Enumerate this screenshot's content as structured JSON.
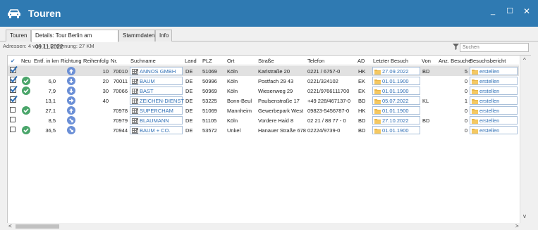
{
  "window": {
    "title": "Touren",
    "icon": "car-icon"
  },
  "window_controls": {
    "minimize": "_",
    "maximize": "☐",
    "close": "✕"
  },
  "tabs": [
    {
      "label": "Touren",
      "active": false
    },
    {
      "label": "Details: Tour Berlin am 09.11.2022",
      "active": true
    },
    {
      "label": "Stammdaten",
      "active": false
    },
    {
      "label": "Info",
      "active": false
    }
  ],
  "info": "Adressen: 4 von 7 - Entfernung: 27 KM",
  "search": {
    "placeholder": "Suchen"
  },
  "columns": {
    "check": "✔",
    "neu": "Neu",
    "entf": "Entf. in km",
    "richtung": "Richtung",
    "reihenfolge": "Reihenfolg",
    "nr": "Nr.",
    "suchname": "Suchname",
    "land": "Land",
    "plz": "PLZ",
    "ort": "Ort",
    "strasse": "Straße",
    "telefon": "Telefon",
    "ad": "AD",
    "letzter": "Letzter Besuch",
    "von": "Von",
    "anz": "Anz. Besuche",
    "bericht": "Besuchsbericht"
  },
  "rows": [
    {
      "checked": true,
      "neu": false,
      "entf": "",
      "richtung": "up",
      "reihenfolge": "10",
      "nr": "70010",
      "suchname": "ANNOS GMBH",
      "land": "DE",
      "plz": "51069",
      "ort": "Köln",
      "strasse": "Karlstraße 20",
      "telefon": "0221 / 6757-0",
      "ad": "HK",
      "letzter": "27.09.2022",
      "von": "BD",
      "anz": "5",
      "bericht": "erstellen",
      "selected": true
    },
    {
      "checked": true,
      "neu": true,
      "entf": "6,0",
      "richtung": "down",
      "reihenfolge": "20",
      "nr": "70011",
      "suchname": "BAUM",
      "land": "DE",
      "plz": "50996",
      "ort": "Köln",
      "strasse": "Postfach 29 43",
      "telefon": "0221/324102",
      "ad": "EK",
      "letzter": "01.01.1900",
      "von": "",
      "anz": "0",
      "bericht": "erstellen",
      "selected": false
    },
    {
      "checked": true,
      "neu": true,
      "entf": "7,9",
      "richtung": "down",
      "reihenfolge": "30",
      "nr": "70066",
      "suchname": "BAST",
      "land": "DE",
      "plz": "50969",
      "ort": "Köln",
      "strasse": "Wiesenweg 29",
      "telefon": "0221/9766111700",
      "ad": "EK",
      "letzter": "01.01.1900",
      "von": "",
      "anz": "0",
      "bericht": "erstellen",
      "selected": false
    },
    {
      "checked": true,
      "neu": false,
      "entf": "13,1",
      "richtung": "right",
      "reihenfolge": "40",
      "nr": "",
      "suchname": "ZEICHEN-DIENST",
      "land": "DE",
      "plz": "53225",
      "ort": "Bonn-Beul",
      "strasse": "Paulsenstraße 17",
      "telefon": "+49 228/467137-0",
      "ad": "BD",
      "letzter": "05.07.2022",
      "von": "KL",
      "anz": "1",
      "bericht": "erstellen",
      "selected": false
    },
    {
      "checked": false,
      "neu": true,
      "entf": "27,1",
      "richtung": "up",
      "reihenfolge": "",
      "nr": "70978",
      "suchname": "SUPERCHAM",
      "land": "DE",
      "plz": "51069",
      "ort": "Mannheim",
      "strasse": "Gewerbepark West",
      "telefon": "09823-5456787-0",
      "ad": "HK",
      "letzter": "01.01.1900",
      "von": "",
      "anz": "0",
      "bericht": "erstellen",
      "selected": false
    },
    {
      "checked": false,
      "neu": false,
      "entf": "8,5",
      "richtung": "downright",
      "reihenfolge": "",
      "nr": "70979",
      "suchname": "BLAUMANN",
      "land": "DE",
      "plz": "51105",
      "ort": "Köln",
      "strasse": "Vordere Haid 8",
      "telefon": "02 21 / 88 77 - 0",
      "ad": "BD",
      "letzter": "27.10.2022",
      "von": "BD",
      "anz": "0",
      "bericht": "erstellen",
      "selected": false
    },
    {
      "checked": false,
      "neu": true,
      "entf": "36,5",
      "richtung": "downright",
      "reihenfolge": "",
      "nr": "70944",
      "suchname": "BAUM + CO.",
      "land": "DE",
      "plz": "53572",
      "ort": "Unkel",
      "strasse": "Hanauer Straße 678",
      "telefon": "02224/9739-0",
      "ad": "BD",
      "letzter": "01.01.1900",
      "von": "",
      "anz": "0",
      "bericht": "erstellen",
      "selected": false
    }
  ],
  "scroll": {
    "up": "^",
    "down": "v",
    "left": "<",
    "right": ">"
  },
  "colors": {
    "titlebar": "#2f7ab2",
    "link": "#2f6fb5",
    "check_green": "#4aa56a",
    "direction_blue": "#6b8fd6",
    "selected_row": "#e1e1e1"
  }
}
